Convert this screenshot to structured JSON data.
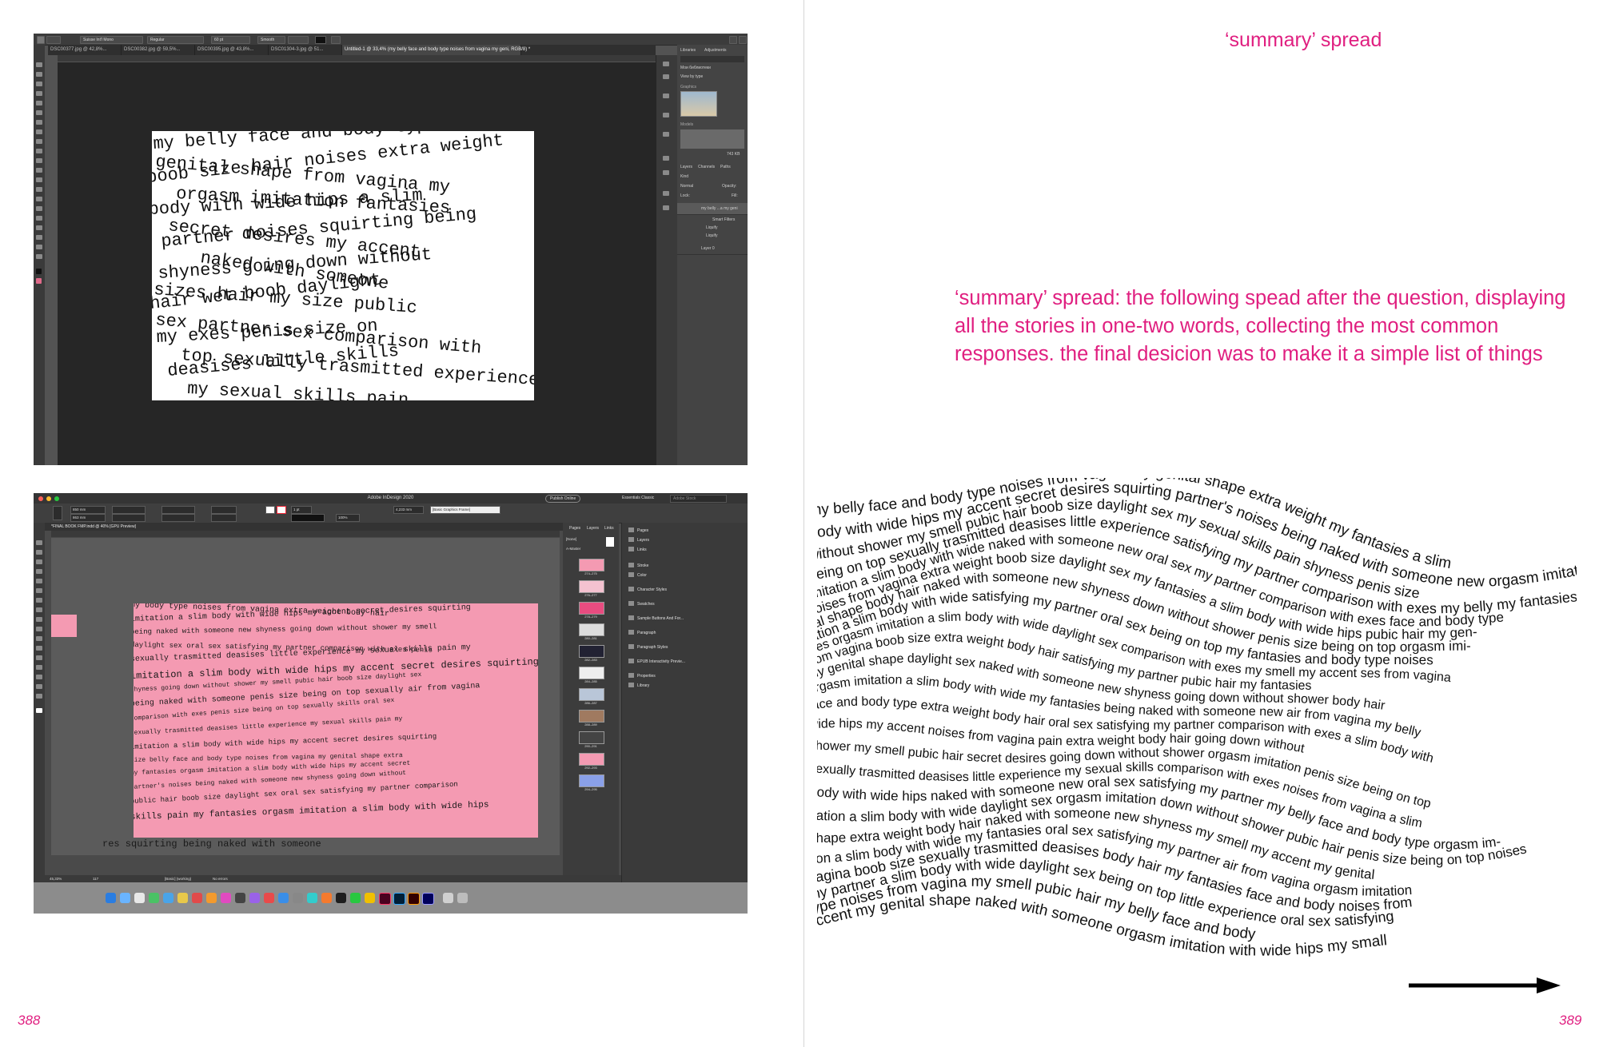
{
  "spread": {
    "left_page_number": "388",
    "right_page_number": "389"
  },
  "right_page": {
    "heading": "‘summary’ spread",
    "description": "‘summary’ spread: the following spead after the question, displaying all the stories in one-two words, collecting the most common responses. the final desicion was to make it a simple list of things"
  },
  "photoshop": {
    "font_name": "Suisse Int'l Mono",
    "font_style": "Regular",
    "font_size": "60 pt",
    "antialias": "Smooth",
    "tabs": [
      "DSC00377.jpg @ 42,8%...",
      "DSC00382.jpg @ 59,5%...",
      "DSC00395.jpg @ 43,8%...",
      "DSC01304-3.jpg @ 51...",
      "Untitled-1 @ 33,4% (my belly     face and body type     noises from vagina     my geni, RGB/8) *"
    ],
    "panel_tabs": [
      "Libraries",
      "Adjustments"
    ],
    "library_name": "Мои библиотеки",
    "view_by": "View by type",
    "section_graphics": "Graphics",
    "section_models": "Models",
    "library_size": "743 KB",
    "layers_tabs": [
      "Layers",
      "Channels",
      "Paths"
    ],
    "layer_kind": "Kind",
    "blend_mode": "Normal",
    "opacity_label": "Opacity:",
    "lock_label": "Lock:",
    "fill_label": "Fill:",
    "layers": [
      "my belly ...a my geni",
      "Smart Filters",
      "Liquify",
      "Liquify",
      "Layer 0"
    ],
    "artwork_lines": [
      "my belly  face and body type",
      "genital shape from vagina my",
      "boob size hair noises extra weight",
      "orgasm imitation fantasies",
      "body with wide hips a slim",
      "secret desires my accent",
      "partner noises squirting being",
      "naked with someone",
      "shyness going down without",
      "sizes hair my size public",
      "hair wet boob daylight",
      "sex partner sex comparison with",
      "my exes penis size on",
      "top sexually trasmitted experience",
      "deasises little skills",
      "my sexual skills pain"
    ]
  },
  "indesign": {
    "app_title": "Adobe InDesign 2020",
    "publish_button": "Publish Online",
    "workspace": "Essentials Classic",
    "search_placeholder": "Adobe Stock",
    "doc_tab": "*FINAL BOOK FMP.indd @ 40% [GPU Preview]",
    "ctrl_w": "850 mm",
    "ctrl_h": "863 mm",
    "stroke_weight": "1 pt",
    "zoom": "100%",
    "measure": "4,233 mm",
    "frame_style": "[Basic Graphics Frame]",
    "pages_tabs": [
      "Pages",
      "Layers",
      "Links"
    ],
    "pages_none": "[None]",
    "pages_master": "A-Master",
    "thumbs": [
      "274–275",
      "276–277",
      "278–279",
      "280–281",
      "282–283",
      "284–285",
      "286–287",
      "288–289",
      "290–291",
      "292–293",
      "294–295"
    ],
    "pages_footer": "349 Pages in 175 Spreads",
    "right_panel_items": [
      "Pages",
      "Layers",
      "Links",
      "Stroke",
      "Color",
      "Character Styles",
      "Swatches",
      "Sample Buttons And For...",
      "Paragraph",
      "Paragraph Styles",
      "EPUB Interactivity Previe...",
      "Properties",
      "Library"
    ],
    "status_zoom": "45,33%",
    "status_page": "117",
    "status_profile": "[Basic] (working)",
    "status_errors": "No errors",
    "page_lines": [
      "my body type noises from vagina                 extra weight body hair",
      "imitation a slim body with wide hips my accent secret desires squirting",
      "being naked with someone new shyness going down without shower my smell",
      "daylight sex oral sex satisfying my partner comparison with exes penis",
      "sexually trasmitted deasises little experience my sexual skills pain my",
      "imitation a slim body with wide hips my accent secret desires squirting",
      "shyness going down without shower my smell pubic hair boob size daylight sex",
      "being naked with someone penis size being on top sexually air from vagina",
      "comparison with exes penis size being on top sexually skills oral sex",
      "sexually trasmitted deasises little experience my sexual skills pain my",
      "imitation a slim body with wide hips my accent secret desires squirting",
      "size belly face and body type noises from vagina my genital shape extra",
      "my fantasies orgasm imitation a slim body with wide hips my accent secret",
      "partner's noises being naked with someone new shyness going down without",
      "public hair boob size daylight sex oral sex satisfying my partner comparison",
      "skills pain my fantasies orgasm imitation a slim body with wide hips",
      "res squirting          being naked with someone"
    ]
  },
  "wave_text": {
    "lines": [
      "my belly   face and body type   noises from vagina   my genital shape   extra weight   my fantasies   a slim",
      "body with wide hips   my accent   secret desires   squirting   partner's noises   being naked with someone new   orgasm imitation   going down",
      "without shower   my smell   pubic hair   boob size   daylight sex   my sexual skills   pain   shyness   penis size",
      "being on top   sexually trasmitted deasises   little experience   satisfying my partner   comparison with exes   my belly   my fantasies   orgasm",
      "imitation   a slim body with wide   naked with someone new   oral sex   my partner   comparison with exes   face and body type",
      "noises from vagina   extra weight   boob size   daylight sex   my fantasies   a slim body with wide hips   pubic hair   my gen-",
      "ital shape   body hair   naked with someone new   shyness   down without shower   penis size being on top   orgasm imi-",
      "tation   a slim body with wide   satisfying my partner   oral sex   being on top   my fantasies   and body type   noises",
      "sies   orgasm imitation   a slim body with wide   daylight sex   comparison with exes   my smell   my accent   ses from vagina",
      "from vagina   boob size   extra weight   body hair   satisfying my partner   pubic hair   my fantasies",
      "my genital shape   daylight sex   naked with someone new   shyness   going down without shower   body hair",
      "orgasm imitation   a slim body with wide   my fantasies   being naked with someone new   air from vagina   my belly",
      "face and body type   extra weight   body hair   oral sex   satisfying my partner   comparison with exes   a slim body with",
      "wide hips   my accent   noises from vagina   pain   extra weight   body hair   going down without",
      "shower   my smell   pubic hair   secret desires   going down without shower   orgasm imitation   penis size being on top",
      "sexually trasmitted deasises   little experience   my sexual skills   comparison with exes   noises from vagina   a slim",
      "body with wide hips   naked with someone new   oral sex   satisfying my partner   my belly   face and body type   orgasm im-",
      "itation   a slim body with wide   daylight sex   orgasm imitation   down without shower   pubic hair   penis size being on top   noises",
      "shape   extra weight   body hair   naked with someone new   shyness   my smell   my accent   my genital",
      "tion   a slim body with wide   my fantasies   oral sex   satisfying my partner   air from vagina   orgasm imitation",
      "vagina   boob size   sexually trasmitted deasises   body hair   my fantasies   face and body   noises from",
      "my partner   a slim body with wide   daylight sex   being on top   little experience   oral sex   satisfying",
      "type   noises from vagina   my smell   pubic hair   my belly   face and body",
      "accent   my genital shape   naked with someone   orgasm imitation   with wide hips   my small"
    ]
  },
  "colors": {
    "accent_magenta": "#e01f80",
    "indesign_page_pink": "#f49ab2"
  }
}
